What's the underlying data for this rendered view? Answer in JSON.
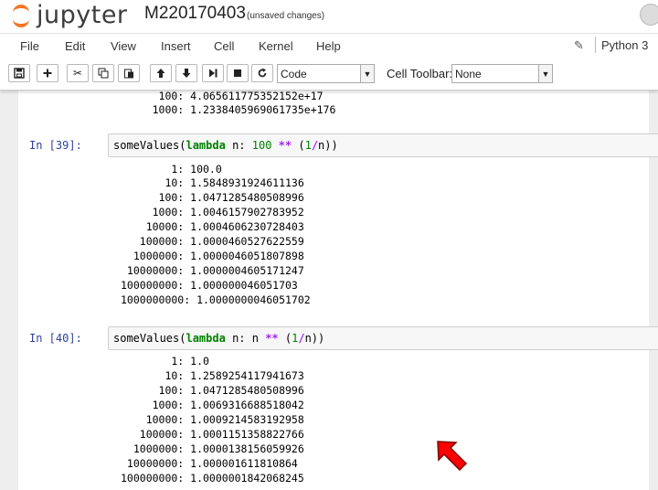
{
  "header": {
    "logo_text": "jupyter",
    "notebook_name": "M220170403",
    "save_status": "(unsaved changes)"
  },
  "menu": [
    "File",
    "Edit",
    "View",
    "Insert",
    "Cell",
    "Kernel",
    "Help"
  ],
  "kernel": {
    "name": "Python 3"
  },
  "toolbar": {
    "buttons": [
      "save-icon",
      "plus-icon",
      "cut-icon",
      "copy-icon",
      "paste-icon",
      "arrow-up-icon",
      "arrow-down-icon",
      "step-run-icon",
      "stop-icon",
      "restart-icon"
    ],
    "cell_type": "Code",
    "cell_toolbar_label": "Cell Toolbar:",
    "cell_toolbar_value": "None"
  },
  "prev_output": [
    "      100: 4.065611775352152e+17",
    "     1000: 1.2338405969061735e+176"
  ],
  "cell39": {
    "prompt": "In [39]:",
    "code": {
      "fn": "someValues(",
      "kw": "lambda",
      "mid": " n: ",
      "num": "100",
      "sp": " ",
      "op": "**",
      "tail_a": " (",
      "one": "1",
      "slash": "/",
      "tail_b": "n))"
    },
    "output": [
      "        1: 100.0",
      "       10: 1.5848931924611136",
      "      100: 1.0471285480508996",
      "     1000: 1.0046157902783952",
      "    10000: 1.0004606230728403",
      "   100000: 1.0000460527622559",
      "  1000000: 1.0000046051807898",
      " 10000000: 1.0000004605171247",
      "100000000: 1.000000046051703",
      "1000000000: 1.0000000046051702"
    ]
  },
  "cell40": {
    "prompt": "In [40]:",
    "code": {
      "fn": "someValues(",
      "kw": "lambda",
      "mid": " n: n ",
      "op": "**",
      "tail_a": " (",
      "one": "1",
      "slash": "/",
      "tail_b": "n))"
    },
    "output": [
      "        1: 1.0",
      "       10: 1.2589254117941673",
      "      100: 1.0471285480508996",
      "     1000: 1.0069316688518042",
      "    10000: 1.0009214583192958",
      "   100000: 1.0001151358822766",
      "  1000000: 1.0000138156059926",
      " 10000000: 1.000001611810864",
      "100000000: 1.0000001842068245"
    ]
  },
  "colors": {
    "accent": "#f37726",
    "prompt": "#303f9f",
    "cursor": "#ff0000"
  }
}
